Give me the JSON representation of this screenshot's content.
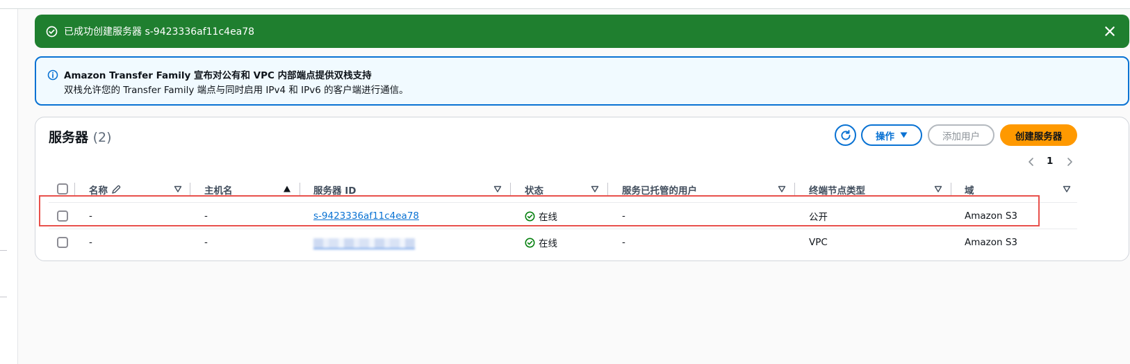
{
  "flash": {
    "message": "已成功创建服务器 s-9423336af11c4ea78",
    "bg_color": "#1f7f2f"
  },
  "info": {
    "title": "Amazon Transfer Family 宣布对公有和 VPC 内部端点提供双栈支持",
    "body": "双栈允许您的 Transfer Family 端点与同时启用 IPv4 和 IPv6 的客户端进行通信。",
    "accent": "#0972d3"
  },
  "servers": {
    "title": "服务器",
    "count": "(2)",
    "actions_label": "操作",
    "add_user_label": "添加用户",
    "create_label": "创建服务器",
    "create_color": "#ff9900",
    "page": "1",
    "columns": [
      "名称",
      "主机名",
      "服务器 ID",
      "状态",
      "服务已托管的用户",
      "终端节点类型",
      "域"
    ],
    "rows": [
      {
        "name": "-",
        "host": "-",
        "id": "s-9423336af11c4ea78",
        "status": "在线",
        "users": "-",
        "endpoint": "公开",
        "domain": "Amazon S3"
      },
      {
        "name": "-",
        "host": "-",
        "id": "",
        "status": "在线",
        "users": "-",
        "endpoint": "VPC",
        "domain": "Amazon S3"
      }
    ]
  },
  "icons": [
    "check-circle-icon",
    "close-icon",
    "info-icon",
    "refresh-icon",
    "caret-down-icon",
    "chevron-left-icon",
    "chevron-right-icon",
    "edit-icon",
    "sort-down-icon",
    "sort-up-icon",
    "status-ok-icon"
  ]
}
